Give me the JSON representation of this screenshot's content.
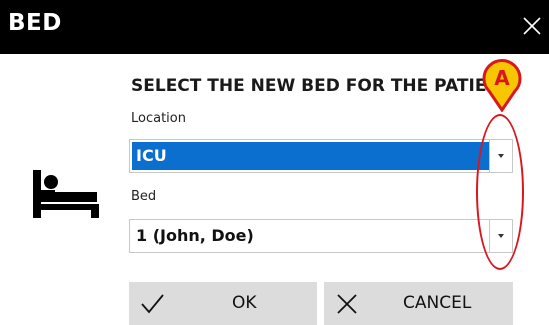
{
  "dialog": {
    "title": "BED",
    "heading": "SELECT THE NEW BED FOR THE PATIENT"
  },
  "location": {
    "label": "Location",
    "value": "ICU"
  },
  "bed": {
    "label": "Bed",
    "value": "1 (John, Doe)"
  },
  "buttons": {
    "ok_label": "OK",
    "cancel_label": "CANCEL"
  },
  "callout": {
    "letter": "A",
    "color": "#d8181e",
    "fill": "#f7c600"
  },
  "colors": {
    "titlebar": "#000000",
    "selection": "#0a6fcf",
    "button": "#dcdcdc"
  },
  "icons": [
    "close-icon",
    "bed-icon",
    "check-icon",
    "cancel-x-icon",
    "dropdown-arrow-icon"
  ]
}
